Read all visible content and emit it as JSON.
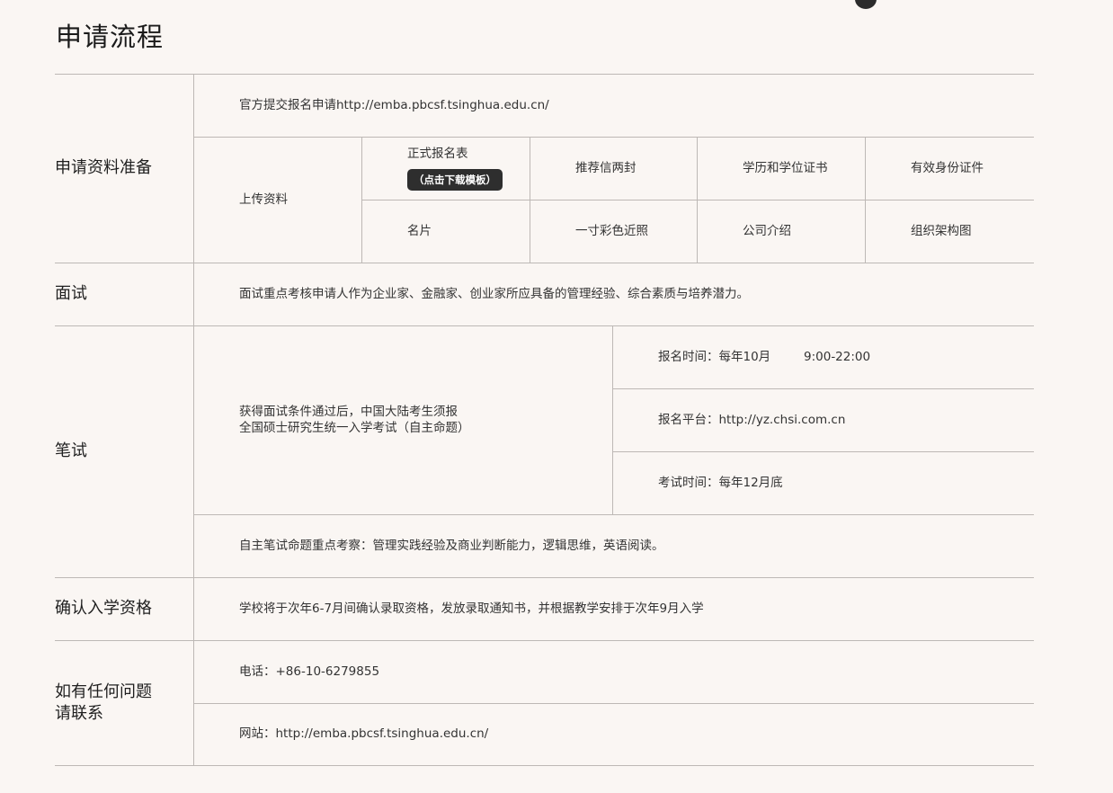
{
  "page": {
    "title": "申请流程"
  },
  "sections": {
    "materials": {
      "label": "申请资料准备",
      "online": "官方提交报名申请http://emba.pbcsf.tsinghua.edu.cn/",
      "upload_label": "上传资料",
      "items": [
        "正式报名表",
        "推荐信两封",
        "学历和学位证书",
        "有效身份证件",
        "名片",
        "一寸彩色近照",
        "公司介绍",
        "组织架构图"
      ],
      "download_button": "（点击下载模板）"
    },
    "interview": {
      "label": "面试",
      "desc": "面试重点考核申请人作为企业家、金融家、创业家所应具备的管理经验、综合素质与培养潜力。"
    },
    "written": {
      "label": "笔试",
      "condition": "获得面试条件通过后，中国大陆考生须报\n全国硕士研究生统一入学考试（自主命题）",
      "reg_time_label": "报名时间：每年10月",
      "reg_time_hours": "9:00-22:00",
      "platform": "报名平台：http://yz.chsi.com.cn",
      "exam_time": "考试时间：每年12月底",
      "focus": "自主笔试命题重点考察：管理实践经验及商业判断能力，逻辑思维，英语阅读。"
    },
    "admission": {
      "label": "确认入学资格",
      "desc": "学校将于次年6-7月间确认录取资格，发放录取通知书，并根据教学安排于次年9月入学"
    },
    "contact": {
      "label": "如有任何问题\n请联系",
      "phone": "电话：+86-10-6279855",
      "website": "网站：http://emba.pbcsf.tsinghua.edu.cn/"
    }
  }
}
